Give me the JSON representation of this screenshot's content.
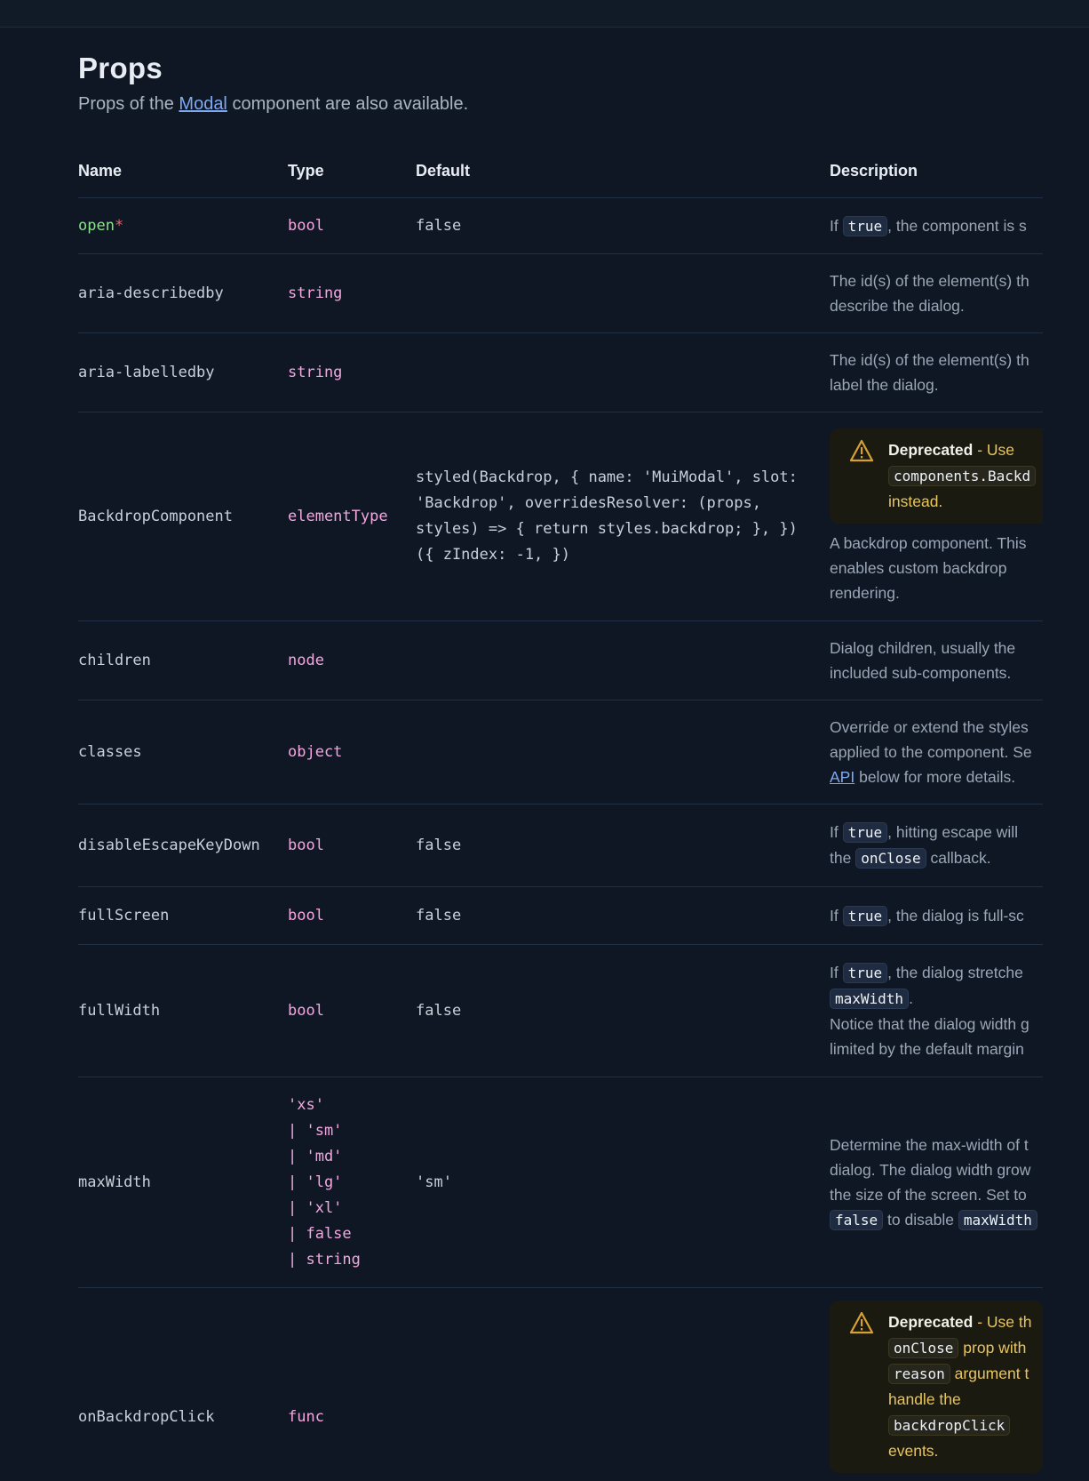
{
  "page": {
    "title": "Props",
    "subtitle_pre": "Props of the ",
    "subtitle_link": "Modal",
    "subtitle_post": " component are also available."
  },
  "table": {
    "headers": {
      "name": "Name",
      "type": "Type",
      "default": "Default",
      "description": "Description"
    },
    "rows": [
      {
        "name": "open",
        "required_mark": "*",
        "type": "bool",
        "default": "false",
        "desc": [
          "If ",
          "true",
          ", the component is s"
        ]
      },
      {
        "name": "aria-describedby",
        "type": "string",
        "default": "",
        "desc": [
          "The id(s) of the element(s) th",
          "describe the dialog."
        ]
      },
      {
        "name": "aria-labelledby",
        "type": "string",
        "default": "",
        "desc": [
          "The id(s) of the element(s) th",
          "label the dialog."
        ]
      },
      {
        "name": "BackdropComponent",
        "type": "elementType",
        "default": "styled(Backdrop, { name: 'MuiModal', slot:\n'Backdrop', overridesResolver: (props,\nstyles) => { return styles.backdrop; }, })\n({ zIndex: -1, })",
        "alert": {
          "label": "Deprecated",
          "text1": " - Use",
          "code1": "components.Backd",
          "text2": "instead."
        },
        "desc": [
          "A backdrop component. This",
          "enables custom backdrop",
          "rendering."
        ]
      },
      {
        "name": "children",
        "type": "node",
        "default": "",
        "desc": [
          "Dialog children, usually the",
          "included sub-components."
        ]
      },
      {
        "name": "classes",
        "type": "object",
        "default": "",
        "desc": [
          "Override or extend the styles",
          "applied to the component. Se",
          "API",
          " below for more details."
        ]
      },
      {
        "name": "disableEscapeKeyDown",
        "type": "bool",
        "default": "false",
        "desc": [
          "If ",
          "true",
          ", hitting escape will ",
          "the ",
          "onClose",
          " callback."
        ]
      },
      {
        "name": "fullScreen",
        "type": "bool",
        "default": "false",
        "desc": [
          "If ",
          "true",
          ", the dialog is full-sc"
        ]
      },
      {
        "name": "fullWidth",
        "type": "bool",
        "default": "false",
        "desc": [
          "If ",
          "true",
          ", the dialog stretche",
          "maxWidth",
          ".",
          "Notice that the dialog width g",
          "limited by the default margin"
        ]
      },
      {
        "name": "maxWidth",
        "type": "'xs'\n| 'sm'\n| 'md'\n| 'lg'\n| 'xl'\n| false\n| string",
        "default": "'sm'",
        "desc": [
          "Determine the max-width of t",
          "dialog. The dialog width grow",
          "the size of the screen. Set to",
          "false",
          " to disable ",
          "maxWidth"
        ]
      },
      {
        "name": "onBackdropClick",
        "type": "func",
        "default": "",
        "alert": {
          "label": "Deprecated",
          "text1": " - Use th",
          "code1": "onClose",
          "text2": " prop with",
          "code2": "reason",
          "text3": " argument t",
          "text4": "handle the",
          "code3": "backdropClick",
          "text5": "events."
        }
      }
    ]
  },
  "colors": {
    "background": "#0f1724",
    "prop_name_required": "#8de08e",
    "type": "#f2a8df",
    "link": "#7fa9f0",
    "warning": "#e8c55d"
  }
}
